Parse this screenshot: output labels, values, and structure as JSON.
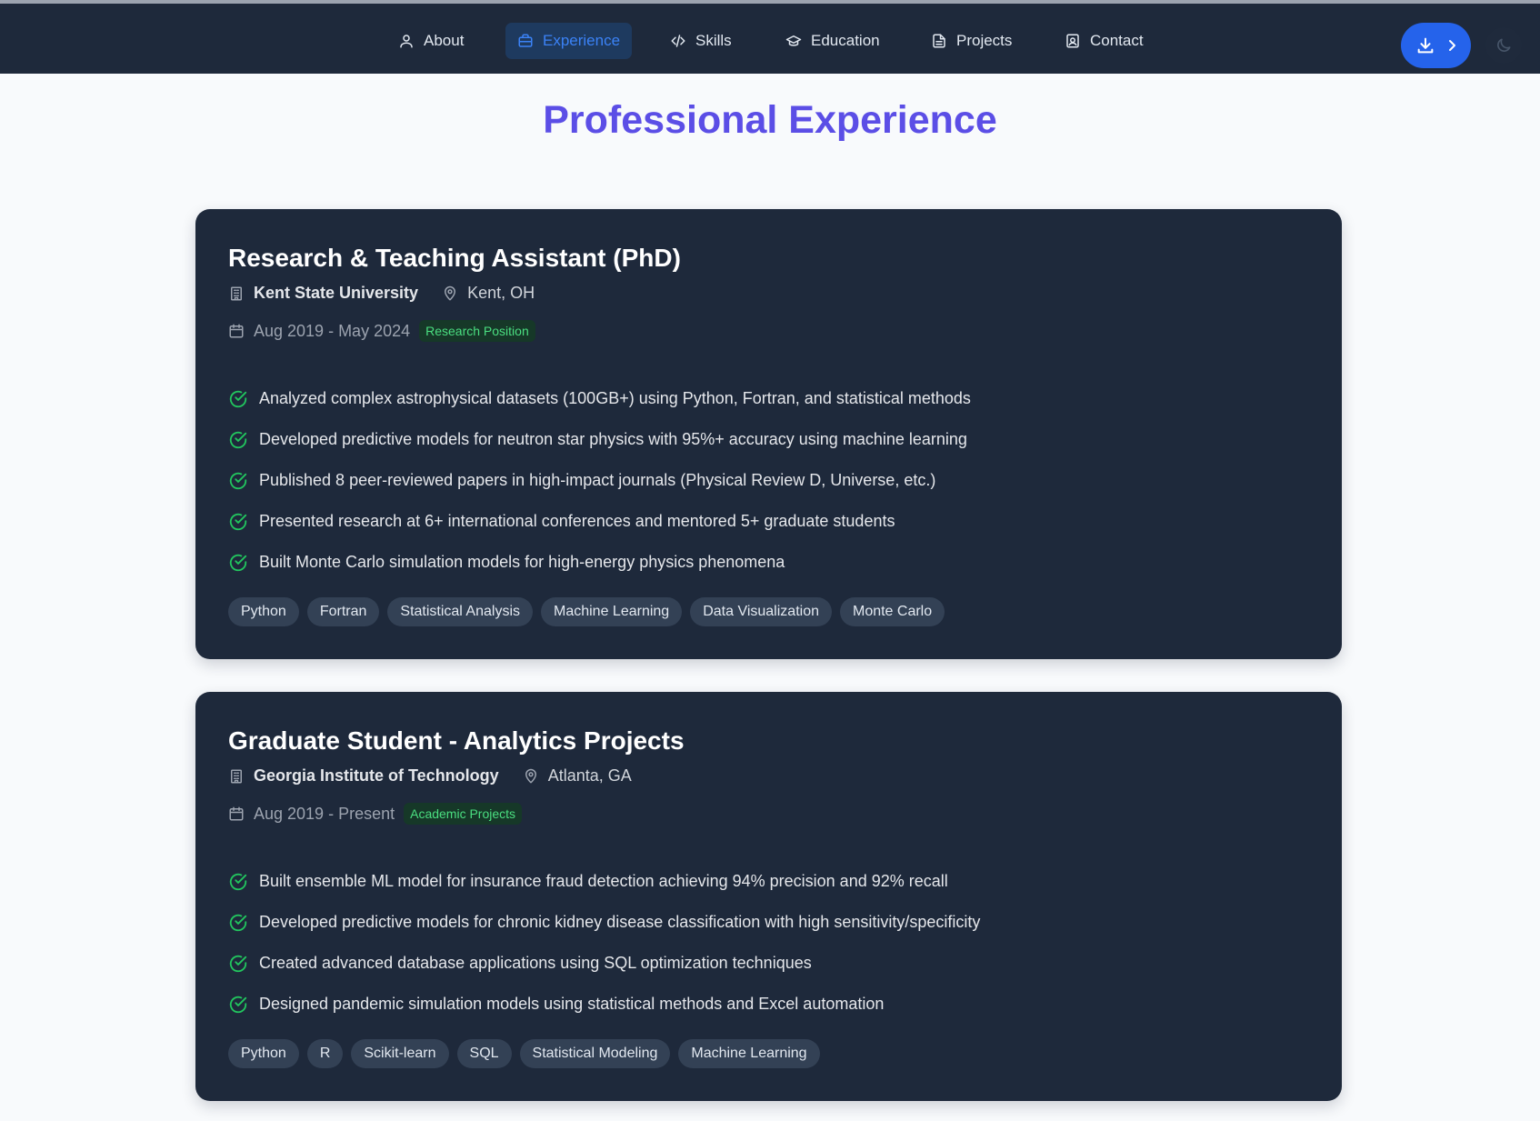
{
  "nav": {
    "items": [
      {
        "label": "About",
        "icon": "user-icon"
      },
      {
        "label": "Experience",
        "icon": "briefcase-icon",
        "active": true
      },
      {
        "label": "Skills",
        "icon": "code-icon"
      },
      {
        "label": "Education",
        "icon": "graduation-cap-icon"
      },
      {
        "label": "Projects",
        "icon": "document-icon"
      },
      {
        "label": "Contact",
        "icon": "contact-icon"
      }
    ],
    "download_icon": "download-icon",
    "theme_icon": "moon-icon"
  },
  "page": {
    "title": "Professional Experience"
  },
  "experiences": [
    {
      "title": "Research & Teaching Assistant (PhD)",
      "organization": "Kent State University",
      "location": "Kent, OH",
      "dates": "Aug 2019 - May 2024",
      "badge": "Research Position",
      "bullets": [
        "Analyzed complex astrophysical datasets (100GB+) using Python, Fortran, and statistical methods",
        "Developed predictive models for neutron star physics with 95%+ accuracy using machine learning",
        "Published 8 peer-reviewed papers in high-impact journals (Physical Review D, Universe, etc.)",
        "Presented research at 6+ international conferences and mentored 5+ graduate students",
        "Built Monte Carlo simulation models for high-energy physics phenomena"
      ],
      "tags": [
        "Python",
        "Fortran",
        "Statistical Analysis",
        "Machine Learning",
        "Data Visualization",
        "Monte Carlo"
      ]
    },
    {
      "title": "Graduate Student - Analytics Projects",
      "organization": "Georgia Institute of Technology",
      "location": "Atlanta, GA",
      "dates": "Aug 2019 - Present",
      "badge": "Academic Projects",
      "bullets": [
        "Built ensemble ML model for insurance fraud detection achieving 94% precision and 92% recall",
        "Developed predictive models for chronic kidney disease classification with high sensitivity/specificity",
        "Created advanced database applications using SQL optimization techniques",
        "Designed pandemic simulation models using statistical methods and Excel automation"
      ],
      "tags": [
        "Python",
        "R",
        "Scikit-learn",
        "SQL",
        "Statistical Modeling",
        "Machine Learning"
      ]
    }
  ],
  "colors": {
    "nav_bg": "#1e293b",
    "accent": "#2563eb",
    "title": "#5b4ee6",
    "card_bg": "#1e293b",
    "check": "#22c55e",
    "badge_text": "#4ade80"
  }
}
